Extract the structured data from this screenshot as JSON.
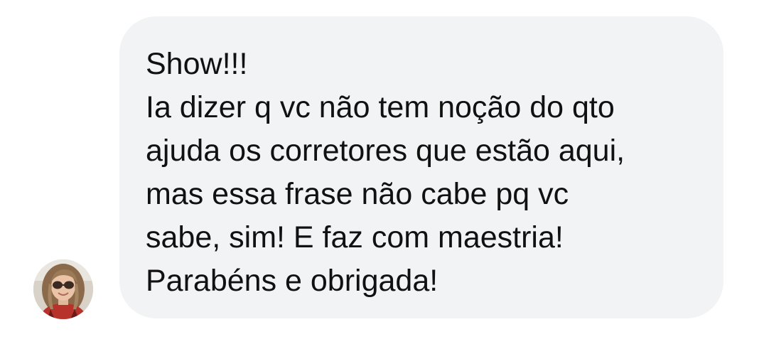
{
  "message": {
    "lines": [
      "Show!!!",
      "Ia dizer q vc não tem noção do qto",
      "ajuda os corretores que estão aqui,",
      "mas essa frase não cabe pq vc",
      "sabe, sim! E faz com maestria!",
      "Parabéns e obrigada!"
    ]
  },
  "sender": {
    "avatar_icon": "profile-photo"
  },
  "colors": {
    "bubble_background": "#f2f3f5",
    "text": "#111111"
  }
}
